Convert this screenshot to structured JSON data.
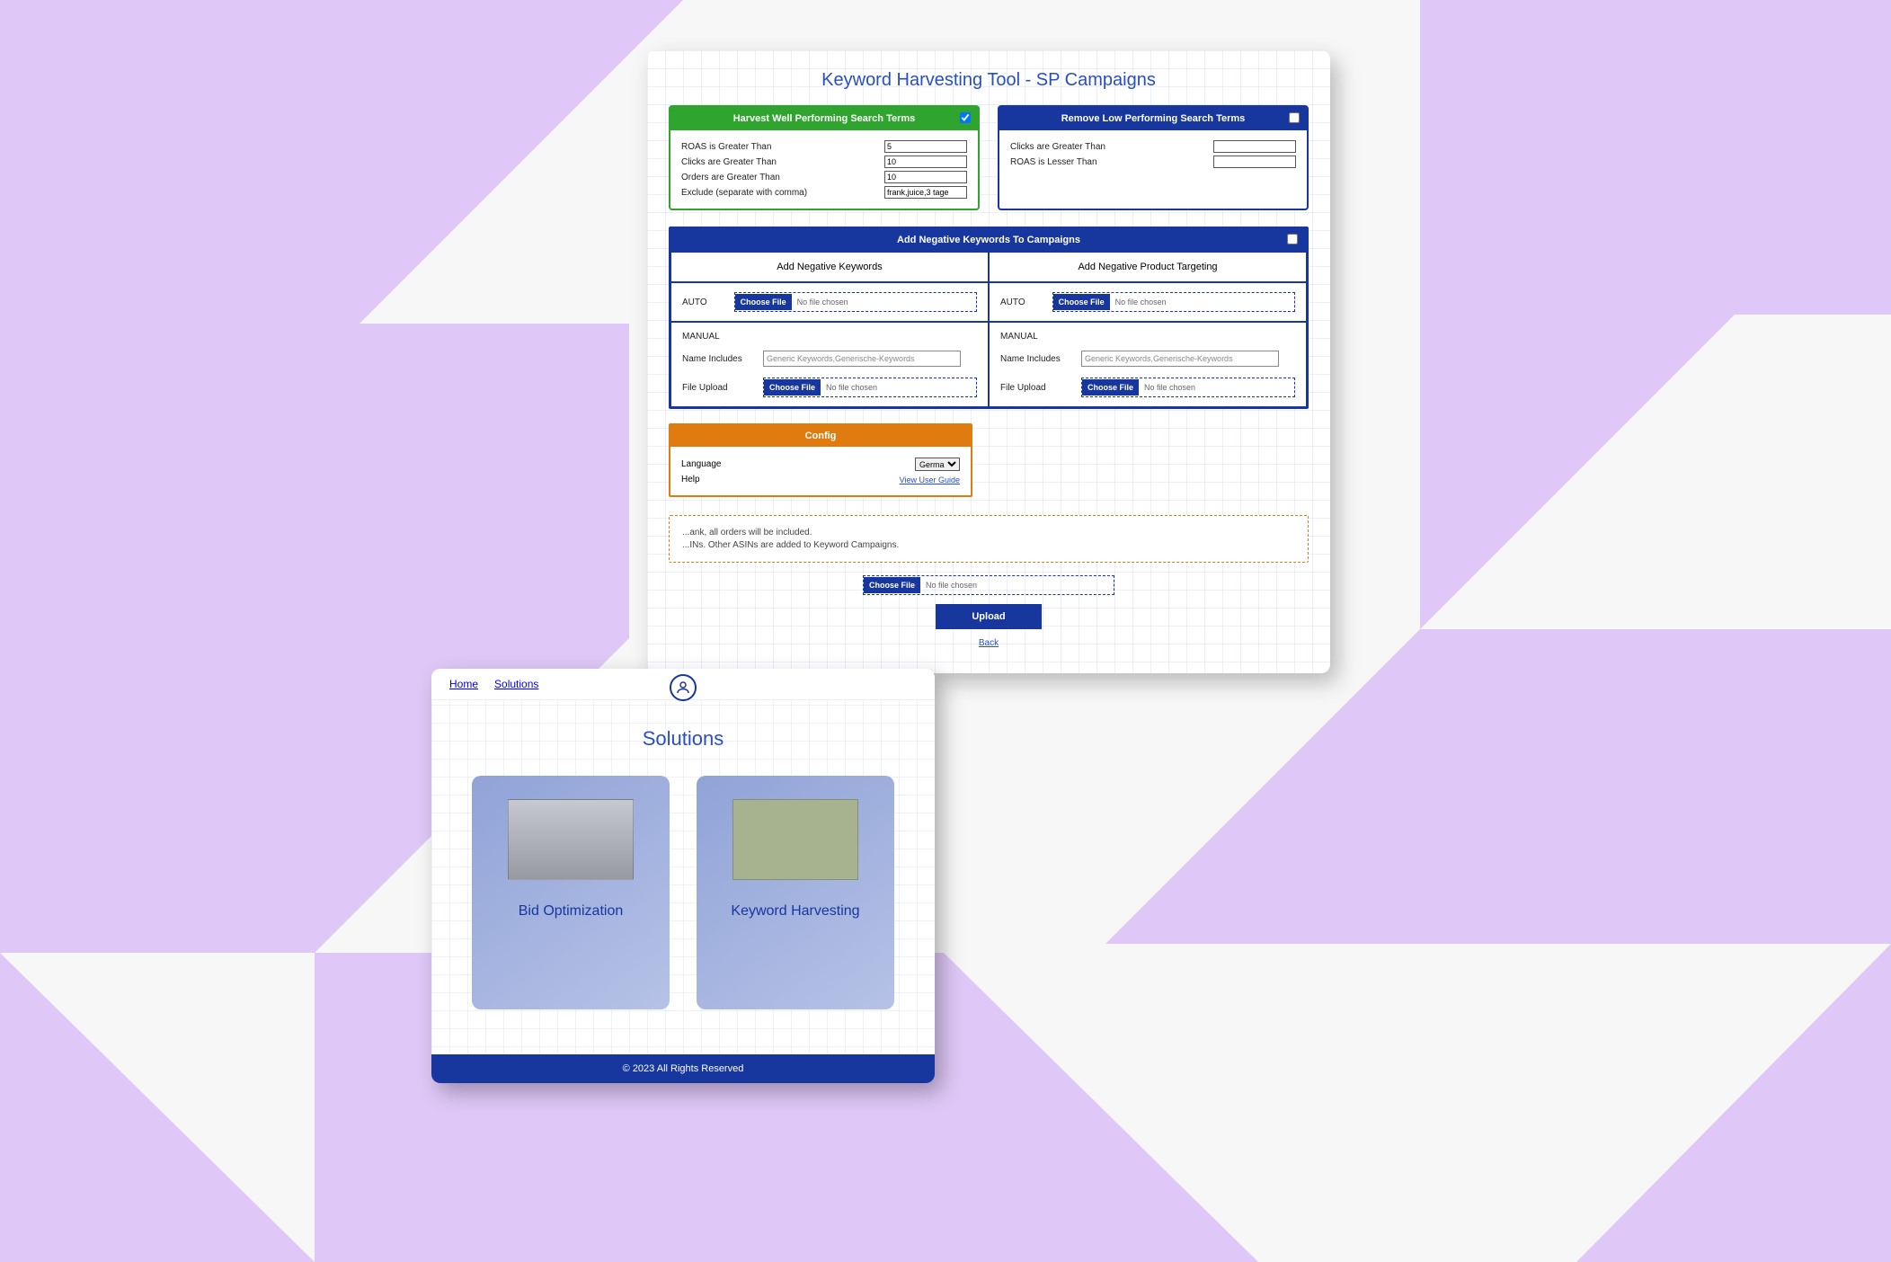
{
  "tool": {
    "title": "Keyword Harvesting Tool - SP Campaigns",
    "harvest": {
      "head": "Harvest Well Performing Search Terms",
      "roas_lbl": "ROAS is Greater Than",
      "roas_val": "5",
      "clicks_lbl": "Clicks are Greater Than",
      "clicks_val": "10",
      "orders_lbl": "Orders are Greater Than",
      "orders_val": "10",
      "exclude_lbl": "Exclude (separate with comma)",
      "exclude_val": "frank,juice,3 tage"
    },
    "remove": {
      "head": "Remove Low Performing Search Terms",
      "clicks_lbl": "Clicks are Greater Than",
      "roas_lbl": "ROAS is Lesser Than"
    },
    "neg": {
      "head": "Add Negative Keywords To Campaigns",
      "left_sub": "Add Negative Keywords",
      "right_sub": "Add Negative Product Targeting",
      "auto": "AUTO",
      "manual": "MANUAL",
      "name_includes": "Name Includes",
      "name_placeholder": "Generic Keywords,Generische-Keywords",
      "file_upload": "File Upload",
      "choose_file": "Choose File",
      "no_file": "No file chosen"
    },
    "config": {
      "head": "Config",
      "lang_lbl": "Language",
      "lang_val": "Germa",
      "help_lbl": "Help",
      "guide": "View User Guide"
    },
    "hints": {
      "l1": "...ank, all orders will be included.",
      "l2": "...INs. Other ASINs are added to Keyword Campaigns."
    },
    "upload_btn": "Upload",
    "back": "Back"
  },
  "solutions": {
    "nav_home": "Home",
    "nav_solutions": "Solutions",
    "title": "Solutions",
    "card1": "Bid Optimization",
    "card2": "Keyword Harvesting",
    "footer": "© 2023 All Rights Reserved"
  }
}
